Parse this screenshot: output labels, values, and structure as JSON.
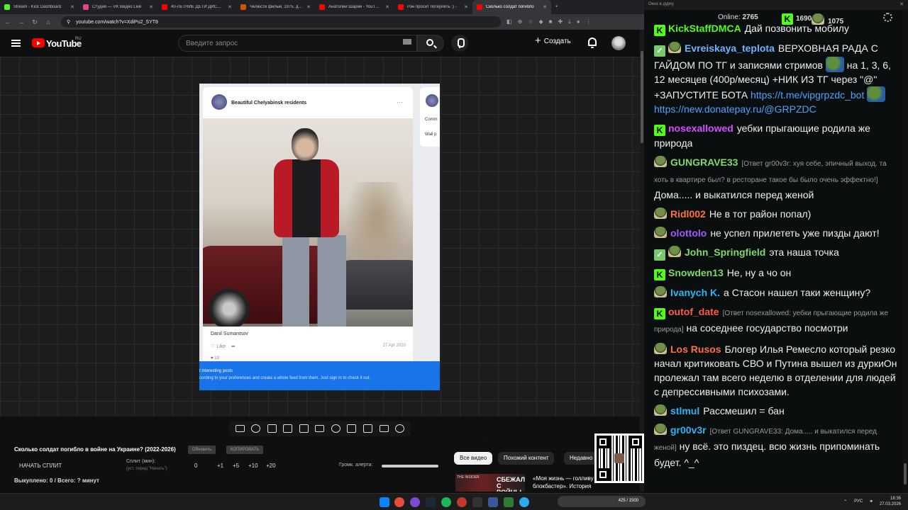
{
  "browser": {
    "tabs": [
      {
        "title": "Stream - Kick Dashboard",
        "color": "#53fc18",
        "active": false
      },
      {
        "title": "Студия — VK Видео Live",
        "color": "#e84393",
        "active": false
      },
      {
        "title": "40-ЛЕТНИЕ ДЕТИ ДИСНЕЯ",
        "color": "#ff0000",
        "active": false
      },
      {
        "title": "Челюсти фильм, 1975, дата",
        "color": "#d35400",
        "active": false
      },
      {
        "title": "Анатолий Шарий - YouTube",
        "color": "#ff0000",
        "active": false
      },
      {
        "title": "Рэн просит потерпеть :) -",
        "color": "#ff0000",
        "active": false
      },
      {
        "title": "Сколько солдат погибло",
        "color": "#ff0000",
        "active": true
      }
    ],
    "new_tab": "+",
    "url": "youtube.com/watch?v=XdiPu2_SYT8"
  },
  "youtube": {
    "logo_text": "YouTube",
    "region": "RU",
    "search_placeholder": "Введите запрос",
    "create_label": "Создать"
  },
  "video": {
    "group_name": "Beautiful Chelyabinsk residents",
    "author": "Danil Sumantsov",
    "like_label": "Like",
    "date": "27 Apr 2020",
    "likes_count": "19",
    "side_line1": "Comm",
    "side_line2": "Wall p",
    "banner_line1": "t interesting posts",
    "banner_line2": "cording to your preferences and create a whole feed from them. Just sign in to check it out."
  },
  "panel": {
    "question": "Сколько солдат погибло в войне на Украине? (2022-2026)",
    "pill_update": "Обновить",
    "pill_copy": "КОПИРОВАТЬ",
    "start_split": "НАЧАТЬ СПЛИТ",
    "split_label": "Сплит (мин):",
    "split_sub": "(уст. перед \"Начать\")",
    "split_values": [
      "0",
      "+1",
      "+5",
      "+10",
      "+20"
    ],
    "alert_label": "Громк. алерта:",
    "bought": "Выкуплено: 0 / Всего: ? минут"
  },
  "recs": {
    "chips": [
      "Все видео",
      "Похожий контент",
      "Недавно"
    ],
    "thumb_channel": "THE INSIDER",
    "thumb_text": "СБЕЖАЛ С ВОЙНЫ",
    "rec_title": "«Моя жизнь — голливу блокбастер». История казак..."
  },
  "chat": {
    "header": "Окно в дурку",
    "online_label": "Online:",
    "online_count": "2765",
    "kick_count": "1690",
    "other_count": "1075",
    "messages": [
      {
        "badges": [
          "kick"
        ],
        "name": "KickStaffDMCA",
        "color": "#53fc18",
        "text": "Дай позвонить мобилу"
      },
      {
        "badges": [
          "verified",
          "pepe"
        ],
        "name": "Evreiskaya_teplota",
        "color": "#6fb3ff",
        "text": "ВЕРХОВНАЯ РАДА С ГАЙДОМ ПО ТГ и записями стримов",
        "text2": "на 1, 3, 6, 12 месяцев (400р/месяц) +НИК ИЗ ТГ через \"@\" +ЗАПУСТИТЕ БОТА",
        "link1": "https://t.me/vipgrpzdc_bot",
        "link2": "https://new.donatepay.ru/@GRPZDC"
      },
      {
        "badges": [
          "kick"
        ],
        "name": "nosexallowed",
        "color": "#d44dff",
        "text": "уебки прыгающие родила же природа"
      },
      {
        "badges": [
          "pepe"
        ],
        "name": "GUNGRAVE33",
        "color": "#7fd96a",
        "reply": "[Ответ gr00v3r: хуя себе, эпичный выход. та хоть в квартире был? в ресторане такое бы было очень эффектно!]",
        "text": "Дома..... и выкатился перед женой"
      },
      {
        "badges": [
          "pepe"
        ],
        "name": "Ridl002",
        "color": "#ff7043",
        "text": "Не в тот район попал)"
      },
      {
        "badges": [
          "pepe"
        ],
        "name": "olottolo",
        "color": "#a259ff",
        "text": "не успел прилететь уже пизды дают!"
      },
      {
        "badges": [
          "verified",
          "pepe"
        ],
        "name": "John_Springfield",
        "color": "#7fd96a",
        "text": "эта наша точка"
      },
      {
        "badges": [
          "kick"
        ],
        "name": "Snowden13",
        "color": "#7fd96a",
        "text": "Не, ну а чо он"
      },
      {
        "badges": [
          "pepe"
        ],
        "name": "Ivanych K.",
        "color": "#29b6f6",
        "text": "а Стасон нашел таки женщину?"
      },
      {
        "badges": [
          "kick"
        ],
        "name": "outof_date",
        "color": "#ff5a4e",
        "reply": "[Ответ nosexallowed: уебки прыгающие родила же природа]",
        "text": "на соседнее государство посмотри"
      },
      {
        "badges": [
          "pepe"
        ],
        "name": "Los Rusos",
        "color": "#ff7043",
        "text": "Блогер Илья Ремесло который резко начал критиковать СВО и Путина вышел из дуркиОн пролежал там всего неделю в отделении для людей с депрессивными психозами."
      },
      {
        "badges": [
          "pepe"
        ],
        "name": "stlmul",
        "color": "#29b6f6",
        "text": "Рассмешил = бан"
      },
      {
        "badges": [
          "pepe"
        ],
        "name": "gr00v3r",
        "color": "#29b6f6",
        "reply": "[Ответ GUNGRAVE33: Дома..... и выкатился перед женой]",
        "text": "ну всё. это пиздец. всю жизнь припоминать будет. ^_^"
      }
    ]
  },
  "taskbar": {
    "lang": "РУС",
    "time": "18:36",
    "date": "27.03.2026",
    "tray_widget": "425 / 1500"
  }
}
